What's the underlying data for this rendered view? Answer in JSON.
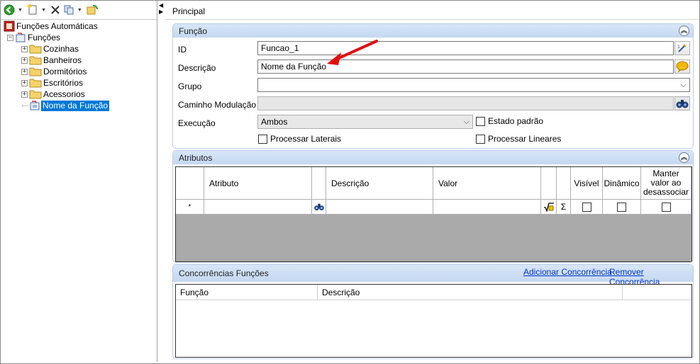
{
  "sidebar": {
    "tree": {
      "root": "Funções Automáticas",
      "group": "Funções",
      "folders": [
        "Cozinhas",
        "Banheiros",
        "Dormitórios",
        "Escritórios",
        "Acessorios"
      ],
      "selected": "Nome da Função"
    }
  },
  "tabs": {
    "active": "Principal"
  },
  "funcao": {
    "title": "Função",
    "id_label": "ID",
    "id_value": "Funcao_1",
    "descricao_label": "Descrição",
    "descricao_value": "Nome da Função",
    "grupo_label": "Grupo",
    "grupo_value": "",
    "caminho_label": "Caminho Modulação",
    "caminho_value": "",
    "execucao_label": "Execução",
    "execucao_value": "Ambos",
    "estado_padrao": "Estado padrão",
    "processar_laterais": "Processar Laterais",
    "processar_lineares": "Processar Lineares"
  },
  "atributos": {
    "title": "Atributos",
    "columns": [
      "Atributo",
      "Descrição",
      "Valor",
      "Visível",
      "Dinâmico",
      "Manter valor ao desassociar"
    ],
    "new_row_marker": "*",
    "sigma": "Σ"
  },
  "concorrencias": {
    "title": "Concorrências Funções",
    "add_link": "Adicionar Concorrência",
    "remove_link": "Remover Concorrência",
    "columns": [
      "Função",
      "Descrição"
    ]
  },
  "colors": {
    "selection": "#0078d7",
    "group_header": "#c4d8f0",
    "annotation_arrow": "#e01010"
  }
}
